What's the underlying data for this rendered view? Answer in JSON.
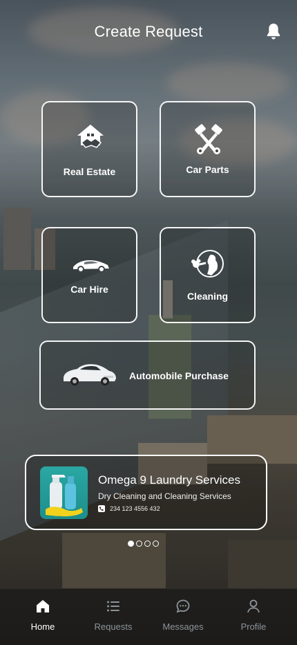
{
  "header": {
    "title": "Create Request",
    "bell_icon": "bell-icon"
  },
  "tiles": {
    "real_estate": "Real Estate",
    "car_parts": "Car Parts",
    "car_hire": "Car Hire",
    "cleaning": "Cleaning",
    "automobile": "Automobile Purchase"
  },
  "promo": {
    "name": "Omega 9 Laundry Services",
    "subtitle": "Dry Cleaning and Cleaning Services",
    "phone": "234 123 4556 432"
  },
  "carousel": {
    "total": 4,
    "active_index": 0
  },
  "nav": {
    "home": "Home",
    "requests": "Requests",
    "messages": "Messages",
    "profile": "Profile",
    "active": "Home"
  },
  "colors": {
    "inactive_nav": "#9aa0a6",
    "active_nav": "#ffffff"
  }
}
